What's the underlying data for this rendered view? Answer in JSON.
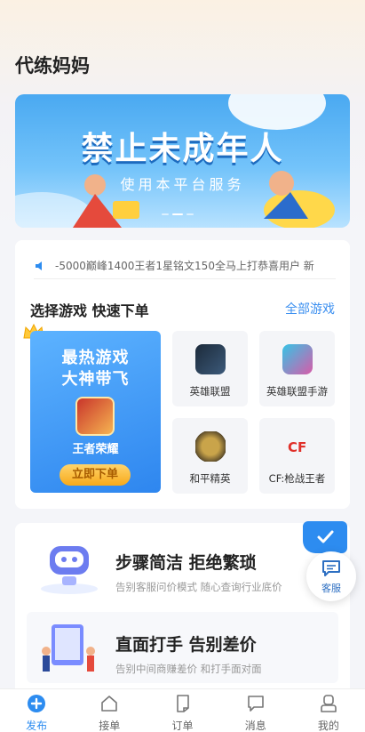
{
  "page": {
    "title": "代练妈妈"
  },
  "banner": {
    "title": "禁止未成年人",
    "subtitle": "使用本平台服务",
    "slide_count": 3,
    "active_slide": 2
  },
  "notice": {
    "text": "-5000巅峰1400王者1星铭文150全马上打恭喜用户 新"
  },
  "games_section": {
    "title": "选择游戏 快速下单",
    "all_link": "全部游戏",
    "promo": {
      "line1": "最热游戏",
      "line2": "大神带飞",
      "game_name": "王者荣耀",
      "button": "立即下单"
    },
    "games": [
      {
        "label": "英雄联盟",
        "icon": "league-of-legends-icon"
      },
      {
        "label": "英雄联盟手游",
        "icon": "lol-wild-rift-icon"
      },
      {
        "label": "和平精英",
        "icon": "peace-elite-icon"
      },
      {
        "label": "CF:枪战王者",
        "icon": "crossfire-icon"
      }
    ]
  },
  "features": [
    {
      "title": "步骤简洁 拒绝繁琐",
      "subtitle": "告别客服问价模式 随心查询行业底价"
    },
    {
      "title": "直面打手 告别差价",
      "subtitle": "告别中间商赚差价 和打手面对面"
    }
  ],
  "floating": {
    "service_label": "客服"
  },
  "tabbar": {
    "active": "发布",
    "items": [
      {
        "label": "发布",
        "icon": "plus-circle-icon"
      },
      {
        "label": "接单",
        "icon": "home-icon"
      },
      {
        "label": "订单",
        "icon": "document-icon"
      },
      {
        "label": "消息",
        "icon": "message-icon"
      },
      {
        "label": "我的",
        "icon": "user-icon"
      }
    ]
  },
  "colors": {
    "accent": "#2d8cf0",
    "link": "#3b8ff0",
    "promo_button": "#f7a91a"
  }
}
